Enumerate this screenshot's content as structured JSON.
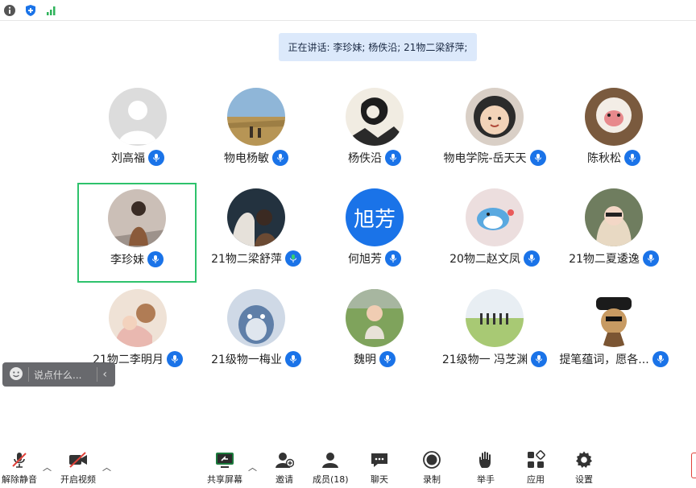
{
  "speaking_banner": "正在讲话: 李珍妹; 杨佚沿; 21物二梁舒萍;",
  "participants": [
    {
      "name": "刘高福",
      "active": false
    },
    {
      "name": "物电杨敏",
      "active": false
    },
    {
      "name": "杨佚沿",
      "active": false
    },
    {
      "name": "物电学院-岳天天",
      "active": false
    },
    {
      "name": "陈秋松",
      "active": false
    },
    {
      "name": "李珍妹",
      "active": true
    },
    {
      "name": "21物二梁舒萍",
      "active": false
    },
    {
      "name": "何旭芳",
      "active": false,
      "initials": "旭芳"
    },
    {
      "name": "20物二赵文凤",
      "active": false
    },
    {
      "name": "21物二夏逶逸",
      "active": false
    },
    {
      "name": "21物二李明月",
      "active": false
    },
    {
      "name": "21级物一梅业",
      "active": false
    },
    {
      "name": "魏明",
      "active": false
    },
    {
      "name": "21级物一 冯芝渊",
      "active": false
    },
    {
      "name": "提笔蕴词，愿各...",
      "active": false
    }
  ],
  "chat": {
    "placeholder": "说点什么..."
  },
  "toolbar": {
    "mute": "解除静音",
    "video": "开启视频",
    "share": "共享屏幕",
    "invite": "邀请",
    "members": "成员(18)",
    "chat": "聊天",
    "record": "录制",
    "raise_hand": "举手",
    "apps": "应用",
    "settings": "设置"
  },
  "colors": {
    "accent": "#1a73e8",
    "active_border": "#2ec26c",
    "banner": "#dce9fb"
  }
}
